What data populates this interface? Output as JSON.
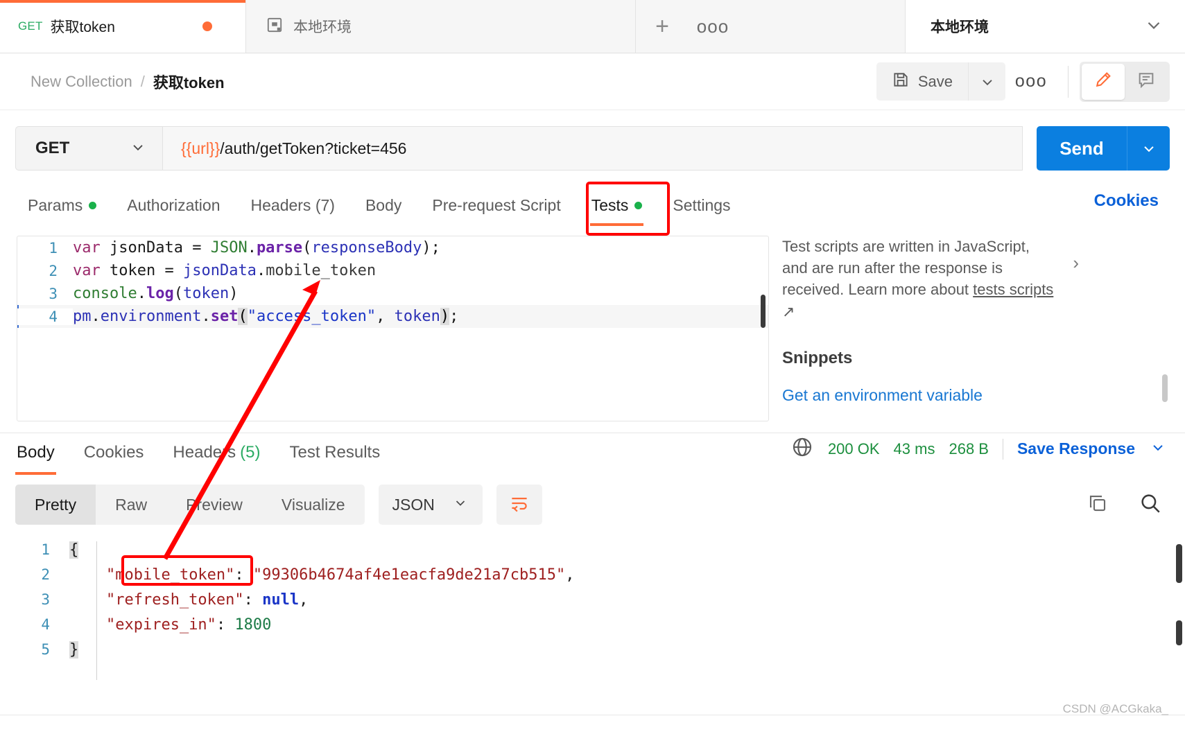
{
  "tabstrip": {
    "request_tab": {
      "method": "GET",
      "name": "获取token",
      "unsaved_dot": "unsaved"
    },
    "env_tab": {
      "name": "本地环境",
      "icon": "console-icon"
    },
    "new_tab_label": "+",
    "more_label": "ooo",
    "env_selector": {
      "value": "本地环境"
    }
  },
  "breadcrumb": {
    "collection": "New Collection",
    "separator": "/",
    "current": "获取token"
  },
  "toolbar": {
    "save_label": "Save",
    "save_caret": "⌄",
    "more_label": "ooo",
    "edit_icon": "pencil-icon",
    "comment_icon": "comment-icon"
  },
  "url_bar": {
    "method": "GET",
    "method_caret": "⌄",
    "url_variable": "{{url}}",
    "url_path": "/auth/getToken?ticket=456",
    "send_label": "Send",
    "send_caret": "⌄"
  },
  "request_tabs": [
    {
      "label": "Params",
      "dot": true,
      "active": false
    },
    {
      "label": "Authorization",
      "dot": false,
      "active": false
    },
    {
      "label": "Headers (7)",
      "dot": false,
      "active": false
    },
    {
      "label": "Body",
      "dot": false,
      "active": false
    },
    {
      "label": "Pre-request Script",
      "dot": false,
      "active": false
    },
    {
      "label": "Tests",
      "dot": true,
      "active": true
    },
    {
      "label": "Settings",
      "dot": false,
      "active": false
    }
  ],
  "cookies_link": "Cookies",
  "editor": {
    "lines": [
      {
        "no": "1",
        "current": false,
        "tokens": [
          {
            "t": "var ",
            "c": "tok-kw"
          },
          {
            "t": "jsonData ",
            "c": "tok-plain"
          },
          {
            "t": "= ",
            "c": "tok-punct"
          },
          {
            "t": "JSON",
            "c": "tok-obj"
          },
          {
            "t": ".",
            "c": "tok-punct"
          },
          {
            "t": "parse",
            "c": "tok-fn"
          },
          {
            "t": "(",
            "c": "tok-punct"
          },
          {
            "t": "responseBody",
            "c": "tok-var"
          },
          {
            "t": ");",
            "c": "tok-punct"
          }
        ]
      },
      {
        "no": "2",
        "current": false,
        "tokens": [
          {
            "t": "var ",
            "c": "tok-kw"
          },
          {
            "t": "token ",
            "c": "tok-plain"
          },
          {
            "t": "= ",
            "c": "tok-punct"
          },
          {
            "t": "jsonData",
            "c": "tok-var"
          },
          {
            "t": ".",
            "c": "tok-punct"
          },
          {
            "t": "mobile_token",
            "c": "tok-ident"
          }
        ]
      },
      {
        "no": "3",
        "current": false,
        "tokens": [
          {
            "t": "console",
            "c": "tok-obj"
          },
          {
            "t": ".",
            "c": "tok-punct"
          },
          {
            "t": "log",
            "c": "tok-fn"
          },
          {
            "t": "(",
            "c": "tok-punct"
          },
          {
            "t": "token",
            "c": "tok-var"
          },
          {
            "t": ")",
            "c": "tok-punct"
          }
        ]
      },
      {
        "no": "4",
        "current": true,
        "tokens": [
          {
            "t": "pm",
            "c": "tok-var"
          },
          {
            "t": ".",
            "c": "tok-punct"
          },
          {
            "t": "environment",
            "c": "tok-var"
          },
          {
            "t": ".",
            "c": "tok-punct"
          },
          {
            "t": "set",
            "c": "tok-fn"
          },
          {
            "t": "(",
            "c": "brace-hl"
          },
          {
            "t": "\"access_token\"",
            "c": "tok-str"
          },
          {
            "t": ", ",
            "c": "tok-punct"
          },
          {
            "t": "token",
            "c": "tok-var"
          },
          {
            "t": ")",
            "c": "brace-hl"
          },
          {
            "t": ";",
            "c": "tok-punct"
          }
        ]
      }
    ]
  },
  "info_panel": {
    "description": "Test scripts are written in JavaScript, and are run after the response is received. Learn more about ",
    "link_text": "tests scripts",
    "link_arrow": "↗",
    "chevron": "›",
    "snippets_title": "Snippets",
    "snippets": [
      "Get an environment variable"
    ]
  },
  "response": {
    "tabs": [
      {
        "label": "Body",
        "active": true
      },
      {
        "label": "Cookies",
        "active": false
      },
      {
        "label": "Headers",
        "count": "(5)",
        "active": false
      },
      {
        "label": "Test Results",
        "active": false
      }
    ],
    "globe_icon": "globe-icon",
    "status": "200 OK",
    "time": "43 ms",
    "size": "268 B",
    "save_response": "Save Response",
    "save_response_caret": "⌄"
  },
  "body_toolbar": {
    "view_modes": [
      {
        "label": "Pretty",
        "active": true
      },
      {
        "label": "Raw",
        "active": false
      },
      {
        "label": "Preview",
        "active": false
      },
      {
        "label": "Visualize",
        "active": false
      }
    ],
    "format": "JSON",
    "format_caret": "⌄",
    "wrap_icon": "word-wrap-icon",
    "copy_icon": "copy-icon",
    "search_icon": "search-icon"
  },
  "response_body": {
    "lines": [
      {
        "no": "1",
        "tokens": [
          {
            "t": "{",
            "c": "j-brace"
          }
        ]
      },
      {
        "no": "2",
        "tokens": [
          {
            "t": "    ",
            "c": "j-punct"
          },
          {
            "t": "\"mobile_token\"",
            "c": "j-key"
          },
          {
            "t": ": ",
            "c": "j-punct"
          },
          {
            "t": "\"99306b4674af4e1eacfa9de21a7cb515\"",
            "c": "j-str"
          },
          {
            "t": ",",
            "c": "j-punct"
          }
        ]
      },
      {
        "no": "3",
        "tokens": [
          {
            "t": "    ",
            "c": "j-punct"
          },
          {
            "t": "\"refresh_token\"",
            "c": "j-key"
          },
          {
            "t": ": ",
            "c": "j-punct"
          },
          {
            "t": "null",
            "c": "j-null"
          },
          {
            "t": ",",
            "c": "j-punct"
          }
        ]
      },
      {
        "no": "4",
        "tokens": [
          {
            "t": "    ",
            "c": "j-punct"
          },
          {
            "t": "\"expires_in\"",
            "c": "j-key"
          },
          {
            "t": ": ",
            "c": "j-punct"
          },
          {
            "t": "1800",
            "c": "j-num"
          }
        ]
      },
      {
        "no": "5",
        "tokens": [
          {
            "t": "}",
            "c": "j-brace"
          }
        ]
      }
    ]
  },
  "annotations": {
    "tests_tab_highlight": "red-box",
    "mobile_token_highlight": "red-box",
    "arrow": "red-arrow"
  },
  "watermark": "CSDN @ACGkaka_",
  "colors": {
    "accent_orange": "#ff6c37",
    "send_blue": "#0b7fe0",
    "link_blue": "#0b61d8",
    "status_green": "#1c8f3e",
    "highlight_red": "#ff0000"
  }
}
